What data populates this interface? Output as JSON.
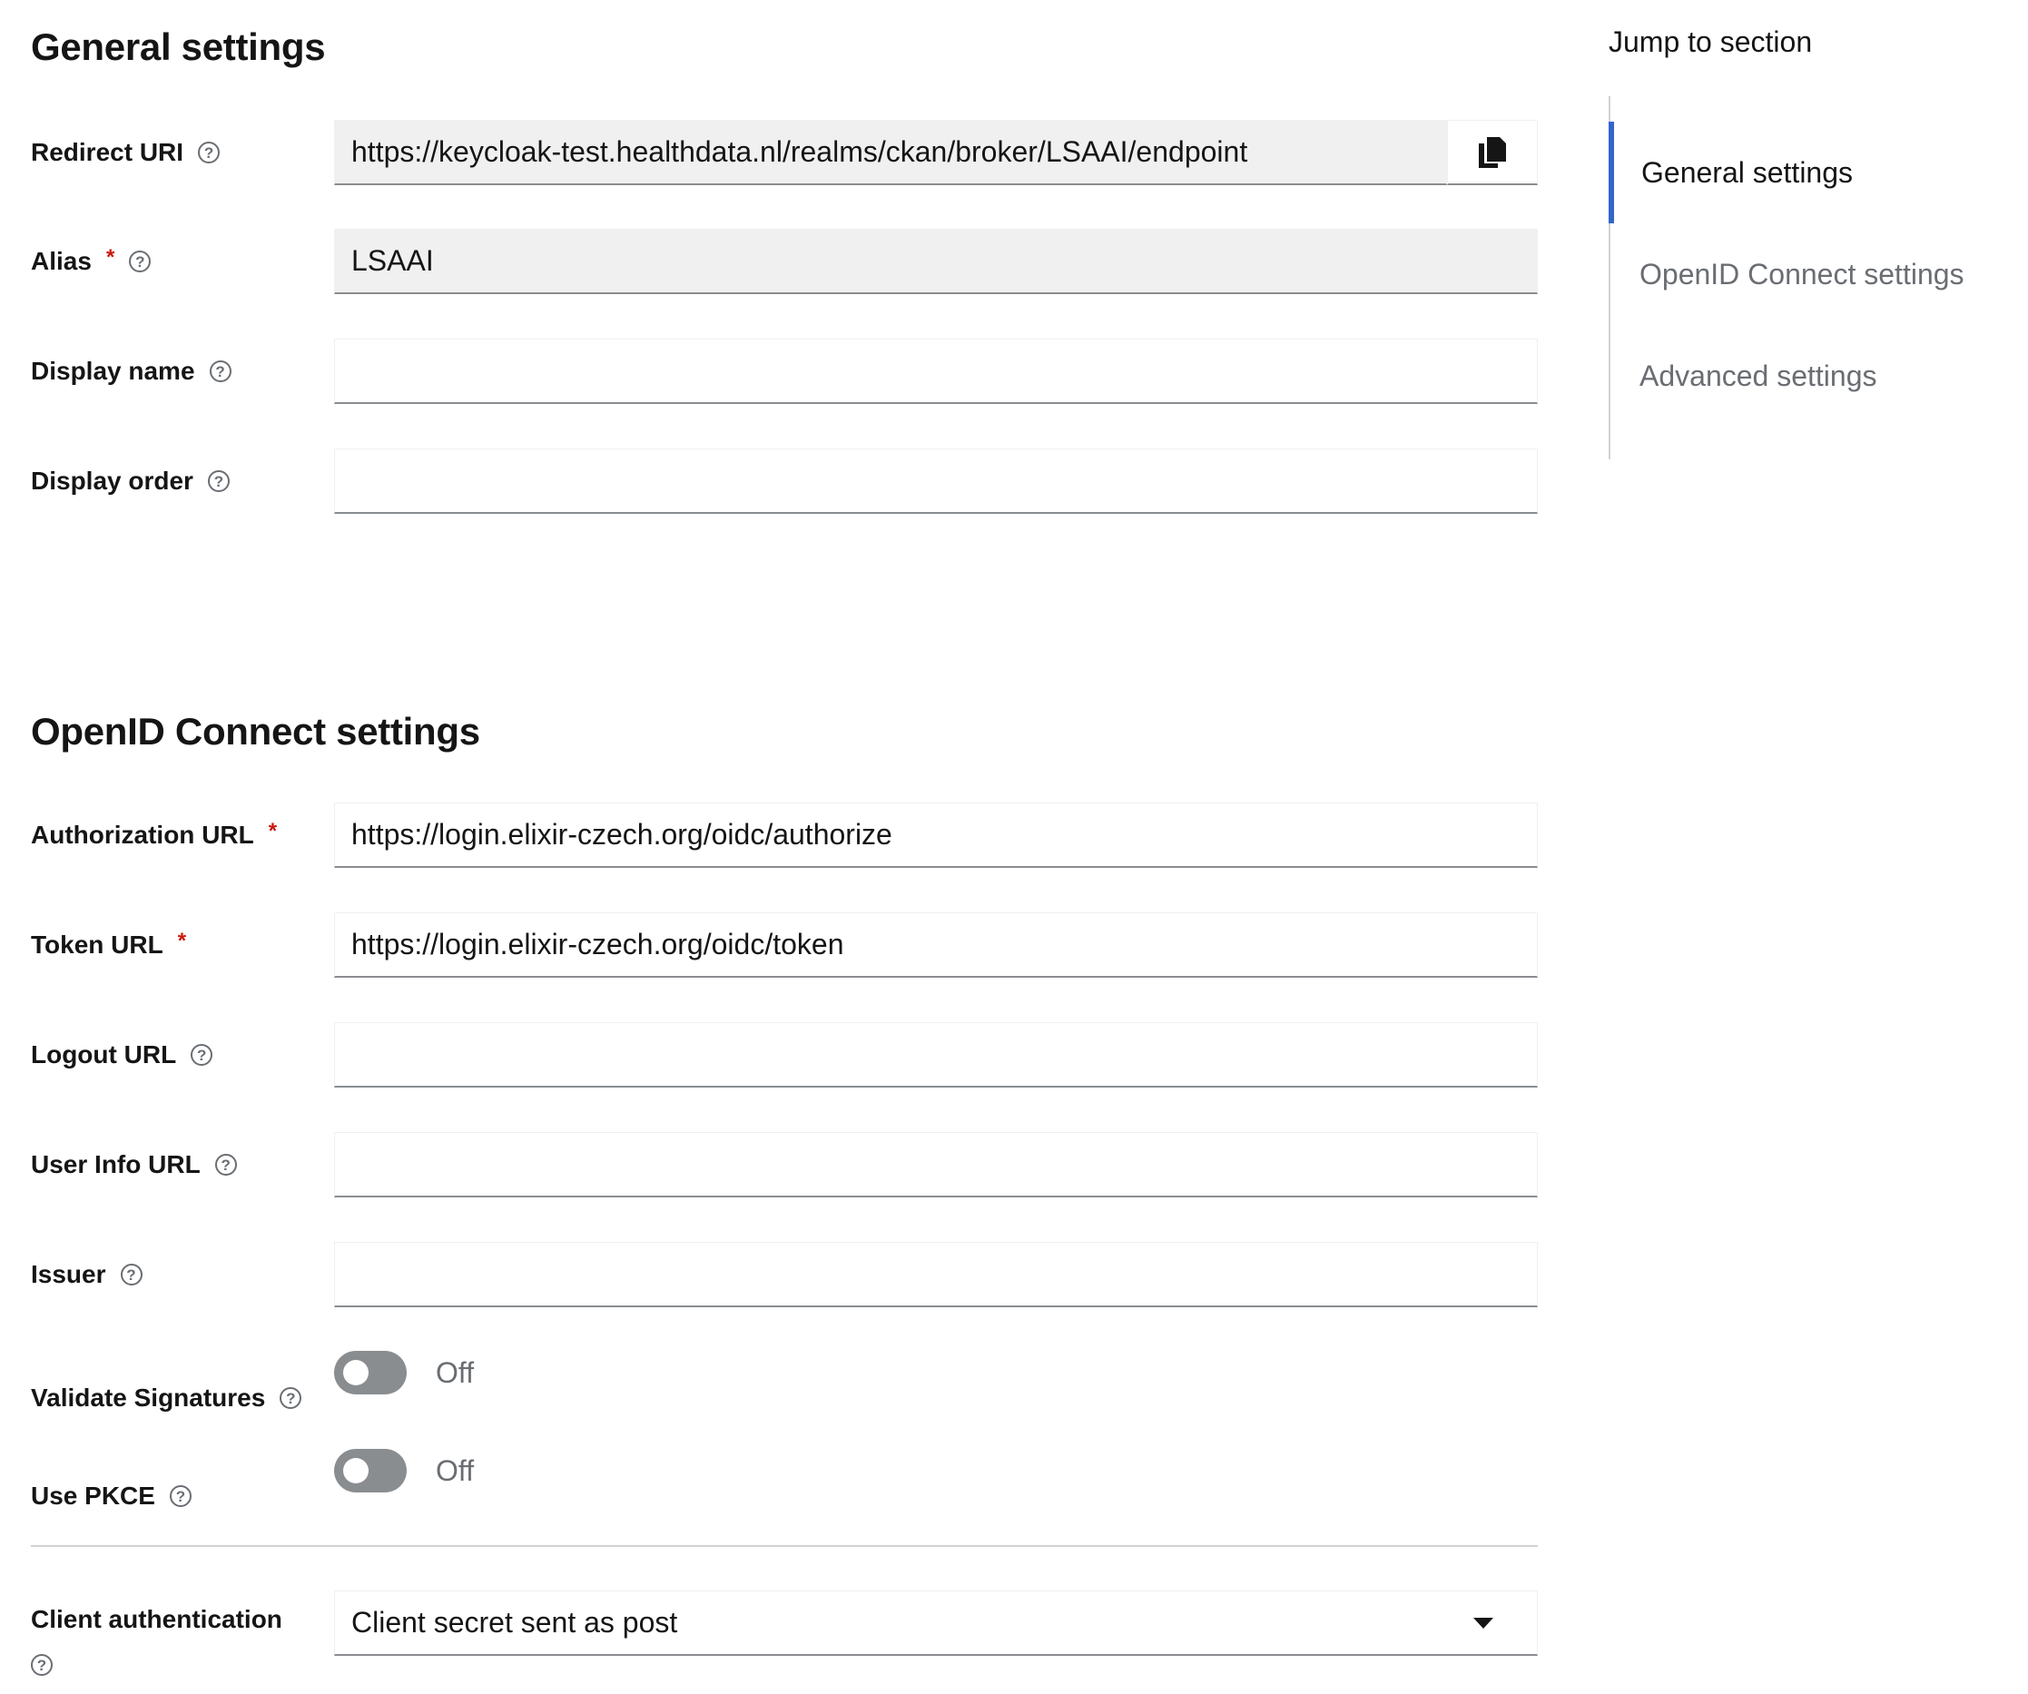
{
  "general": {
    "title": "General settings",
    "redirect_uri": {
      "label": "Redirect URI",
      "value": "https://keycloak-test.healthdata.nl/realms/ckan/broker/LSAAI/endpoint"
    },
    "alias": {
      "label": "Alias",
      "required_mark": "*",
      "value": "LSAAI"
    },
    "display_name": {
      "label": "Display name",
      "value": ""
    },
    "display_order": {
      "label": "Display order",
      "value": ""
    }
  },
  "oidc": {
    "title": "OpenID Connect settings",
    "authorization_url": {
      "label": "Authorization URL",
      "required_mark": "*",
      "value": "https://login.elixir-czech.org/oidc/authorize"
    },
    "token_url": {
      "label": "Token URL",
      "required_mark": "*",
      "value": "https://login.elixir-czech.org/oidc/token"
    },
    "logout_url": {
      "label": "Logout URL",
      "value": ""
    },
    "user_info_url": {
      "label": "User Info URL",
      "value": ""
    },
    "issuer": {
      "label": "Issuer",
      "value": ""
    },
    "validate_signatures": {
      "label": "Validate Signatures",
      "state": "Off"
    },
    "use_pkce": {
      "label": "Use PKCE",
      "state": "Off"
    },
    "client_authentication": {
      "label": "Client authentication",
      "value": "Client secret sent as post"
    }
  },
  "jump": {
    "title": "Jump to section",
    "items": [
      {
        "label": "General settings",
        "active": true
      },
      {
        "label": "OpenID Connect settings",
        "active": false
      },
      {
        "label": "Advanced settings",
        "active": false
      }
    ]
  },
  "help_glyph": "?",
  "icons": {
    "help": "question-circle-icon",
    "copy": "copy-icon",
    "caret": "caret-down-icon"
  },
  "colors": {
    "accent": "#3366cc",
    "required": "#c9190b",
    "toggle_off": "#8a8d90"
  }
}
